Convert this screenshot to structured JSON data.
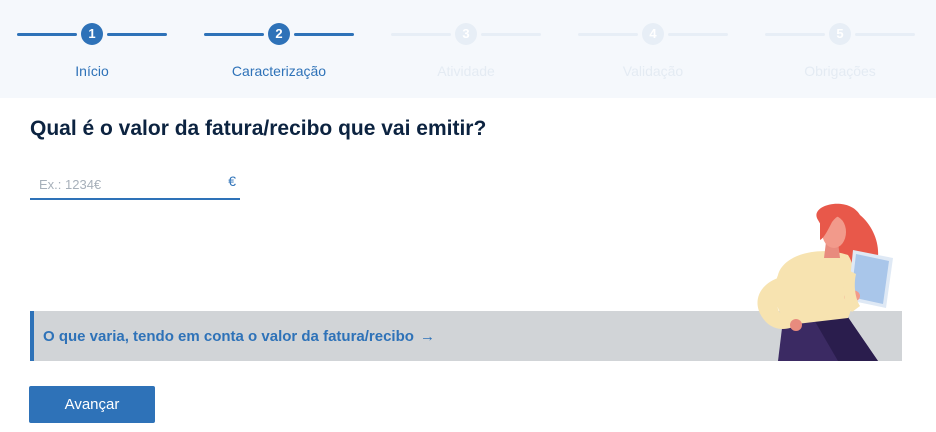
{
  "stepper": {
    "steps": [
      {
        "number": "1",
        "label": "Início",
        "state": "active"
      },
      {
        "number": "2",
        "label": "Caracterização",
        "state": "active"
      },
      {
        "number": "3",
        "label": "Atividade",
        "state": "inactive"
      },
      {
        "number": "4",
        "label": "Validação",
        "state": "inactive"
      },
      {
        "number": "5",
        "label": "Obrigações",
        "state": "inactive"
      }
    ]
  },
  "question": {
    "title": "Qual é o valor da fatura/recibo que vai emitir?"
  },
  "amount_input": {
    "value": "",
    "placeholder": "Ex.: 1234€",
    "currency": "€"
  },
  "info": {
    "link_label": "O que varia, tendo em conta o valor da fatura/recibo",
    "arrow": "→"
  },
  "actions": {
    "next_label": "Avançar"
  },
  "colors": {
    "accent": "#2e72b8",
    "title": "#0c2340",
    "info_background": "#d1d4d7"
  }
}
